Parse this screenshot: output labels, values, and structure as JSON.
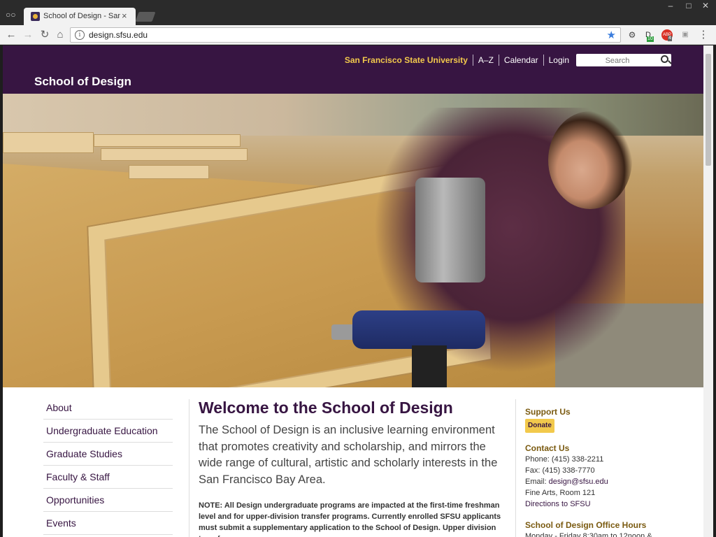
{
  "browser": {
    "tab_title": "School of Design - San F",
    "tab_close": "×",
    "url": "design.sfsu.edu",
    "incognito_icon": "incognito-icon",
    "win_minimize": "–",
    "win_maximize": "□",
    "win_close": "✕",
    "back": "←",
    "forward": "→",
    "reload": "↻",
    "home": "⌂",
    "info": "i",
    "star": "★",
    "ext_settings": "⚙",
    "ext_badge_count": "10",
    "ext_abp_label": "ABP",
    "ext_abp_count": "4",
    "menu": "⋮"
  },
  "header": {
    "university": "San Francisco State University",
    "az": "A–Z",
    "calendar": "Calendar",
    "login": "Login",
    "search_placeholder": "Search",
    "site_title": "School of Design"
  },
  "sidenav": {
    "items": [
      {
        "label": "About"
      },
      {
        "label": "Undergraduate Education"
      },
      {
        "label": "Graduate Studies"
      },
      {
        "label": "Faculty & Staff"
      },
      {
        "label": "Opportunities"
      },
      {
        "label": "Events"
      }
    ]
  },
  "main": {
    "title": "Welcome to the School of Design",
    "intro": "The School of Design is an inclusive learning environment that promotes creativity and scholarship, and mirrors the wide range of cultural, artistic and scholarly interests in the San Francisco Bay Area.",
    "note": "NOTE: All Design undergraduate programs are impacted at the first-time freshman level and for upper-division transfer programs. Currently enrolled SFSU applicants must submit a supplementary application to the School of Design. Upper division transfer"
  },
  "aside": {
    "support_heading": "Support Us",
    "donate": "Donate",
    "contact_heading": "Contact Us",
    "phone": "Phone: (415) 338-2211",
    "fax": "Fax: (415) 338-7770",
    "email_label": "Email: ",
    "email": "design@sfsu.edu",
    "location": "Fine Arts, Room 121",
    "directions": "Directions to SFSU",
    "hours_heading": "School of Design Office Hours",
    "hours": "Monday - Friday 8:30am to 12noon &"
  },
  "colors": {
    "brand_purple": "#371542",
    "brand_gold": "#f2c94c"
  }
}
